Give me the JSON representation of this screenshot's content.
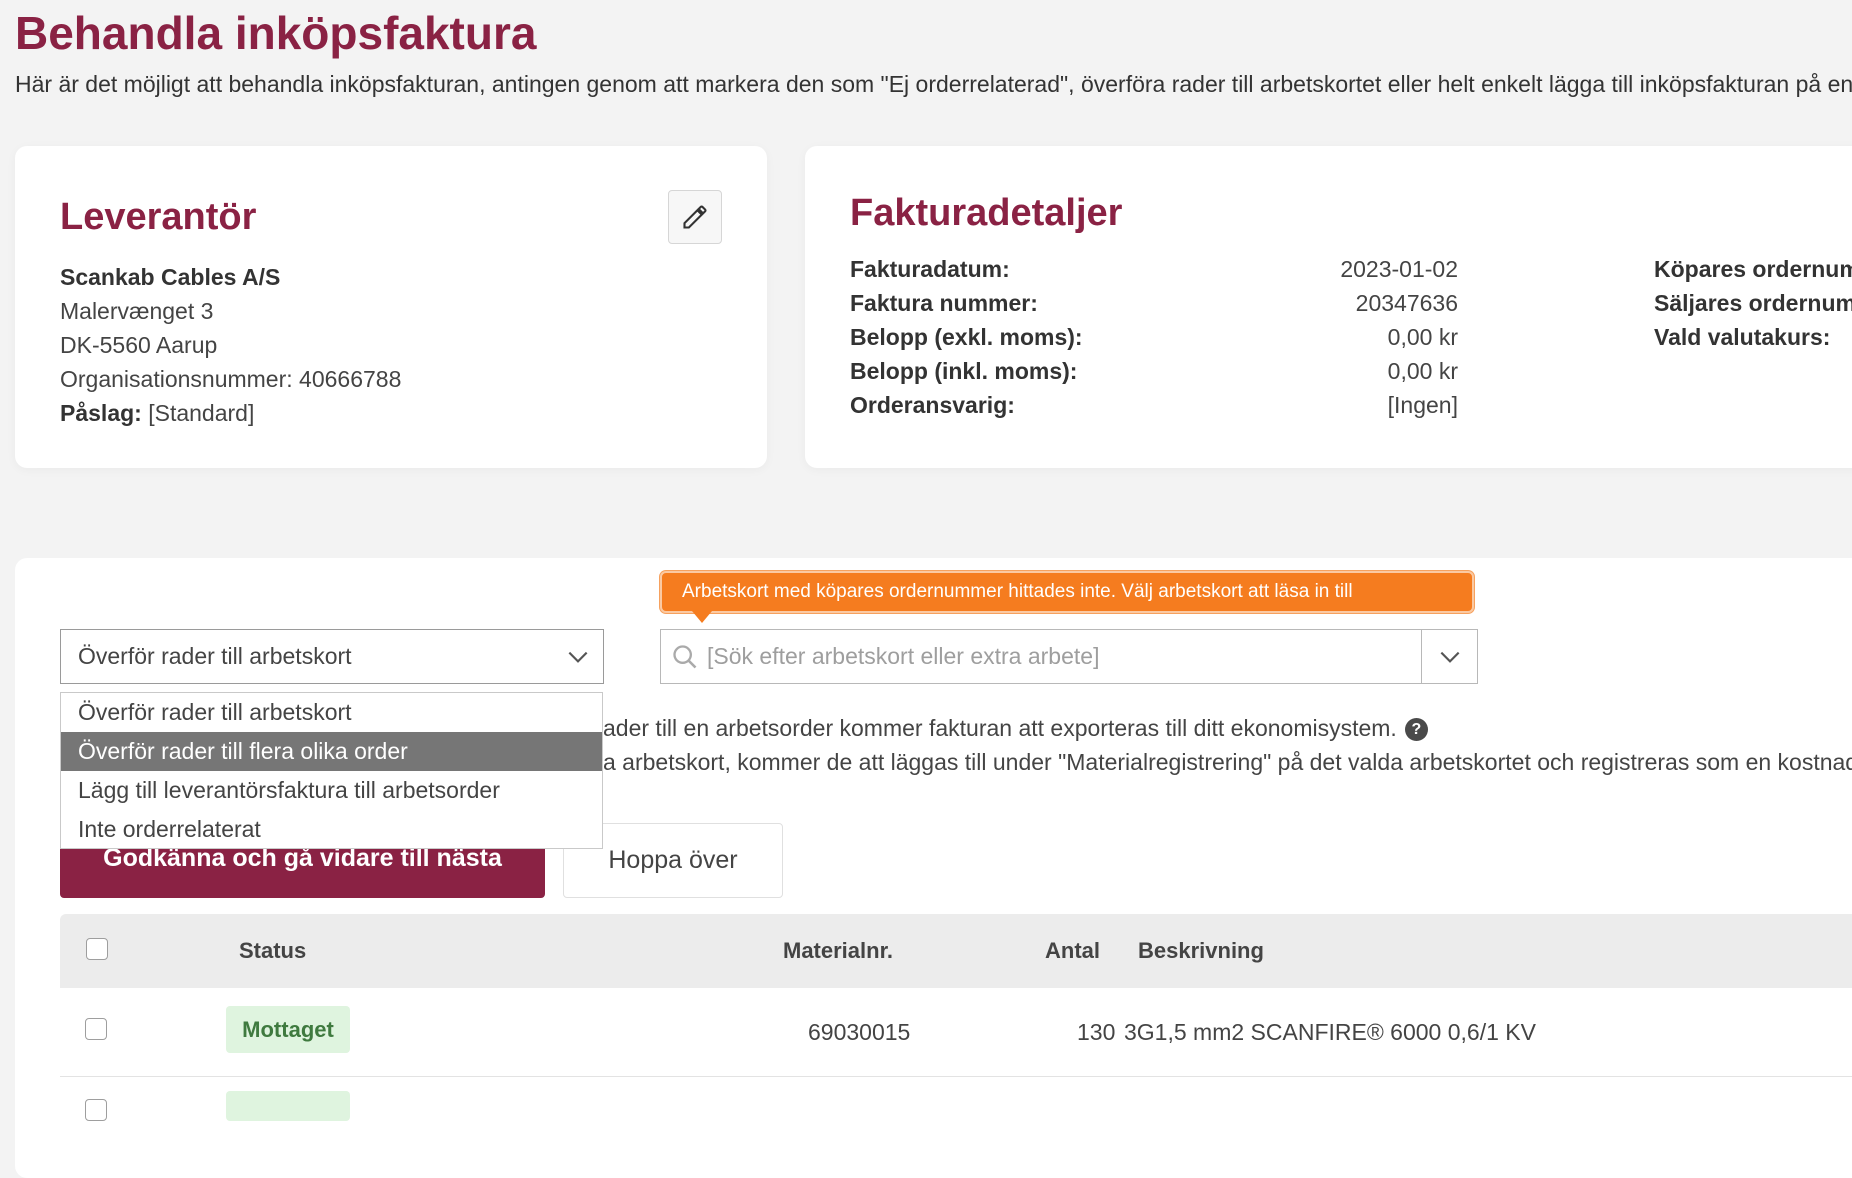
{
  "page": {
    "title": "Behandla inköpsfaktura",
    "subtitle": "Här är det möjligt att behandla inköpsfakturan, antingen genom att markera den som \"Ej orderrelaterad\", överföra rader till arbetskortet eller helt enkelt lägga till inköpsfakturan på en spe"
  },
  "supplier": {
    "title": "Leverantör",
    "name": "Scankab Cables A/S",
    "street": "Malervænget 3",
    "city": "DK-5560 Aarup",
    "org_number": "Organisationsnummer: 40666788",
    "markup_label": "Påslag:",
    "markup_value": "[Standard]"
  },
  "invoice_details": {
    "title": "Fakturadetaljer",
    "rows": [
      {
        "label": "Fakturadatum:",
        "value": "2023-01-02"
      },
      {
        "label": "Faktura nummer:",
        "value": "20347636"
      },
      {
        "label": "Belopp (exkl. moms):",
        "value": "0,00 kr"
      },
      {
        "label": "Belopp (inkl. moms):",
        "value": "0,00 kr"
      },
      {
        "label": "Orderansvarig:",
        "value": "[Ingen]"
      }
    ],
    "right_labels": [
      "Köpares ordernum",
      "Säljares ordernum",
      "Vald valutakurs:"
    ]
  },
  "transfer": {
    "selected": "Överför rader till arbetskort",
    "options": [
      "Överför rader till arbetskort",
      "Överför rader till flera olika order",
      "Lägg till leverantörsfaktura till arbetsorder",
      "Inte orderrelaterat"
    ],
    "search_placeholder": "[Sök efter arbetskort eller extra arbete]",
    "tooltip": "Arbetskort med köpares ordernummer hittades inte. Välj arbetskort att läsa in till",
    "info_line1": "ader till en arbetsorder kommer fakturan att exporteras till ditt ekonomisystem.",
    "info_line2": "a arbetskort, kommer de att läggas till under \"Materialregistrering\" på det valda arbetskortet och registreras som en kostnad.",
    "help_glyph": "?"
  },
  "actions": {
    "approve": "Godkänna och gå vidare till nästa",
    "skip": "Hoppa över"
  },
  "table": {
    "headers": {
      "status": "Status",
      "material": "Materialnr.",
      "qty": "Antal",
      "desc": "Beskrivning"
    },
    "rows": [
      {
        "status": "Mottaget",
        "material": "69030015",
        "qty": "130",
        "desc": "3G1,5 mm2 SCANFIRE® 6000 0,6/1 KV"
      }
    ]
  }
}
